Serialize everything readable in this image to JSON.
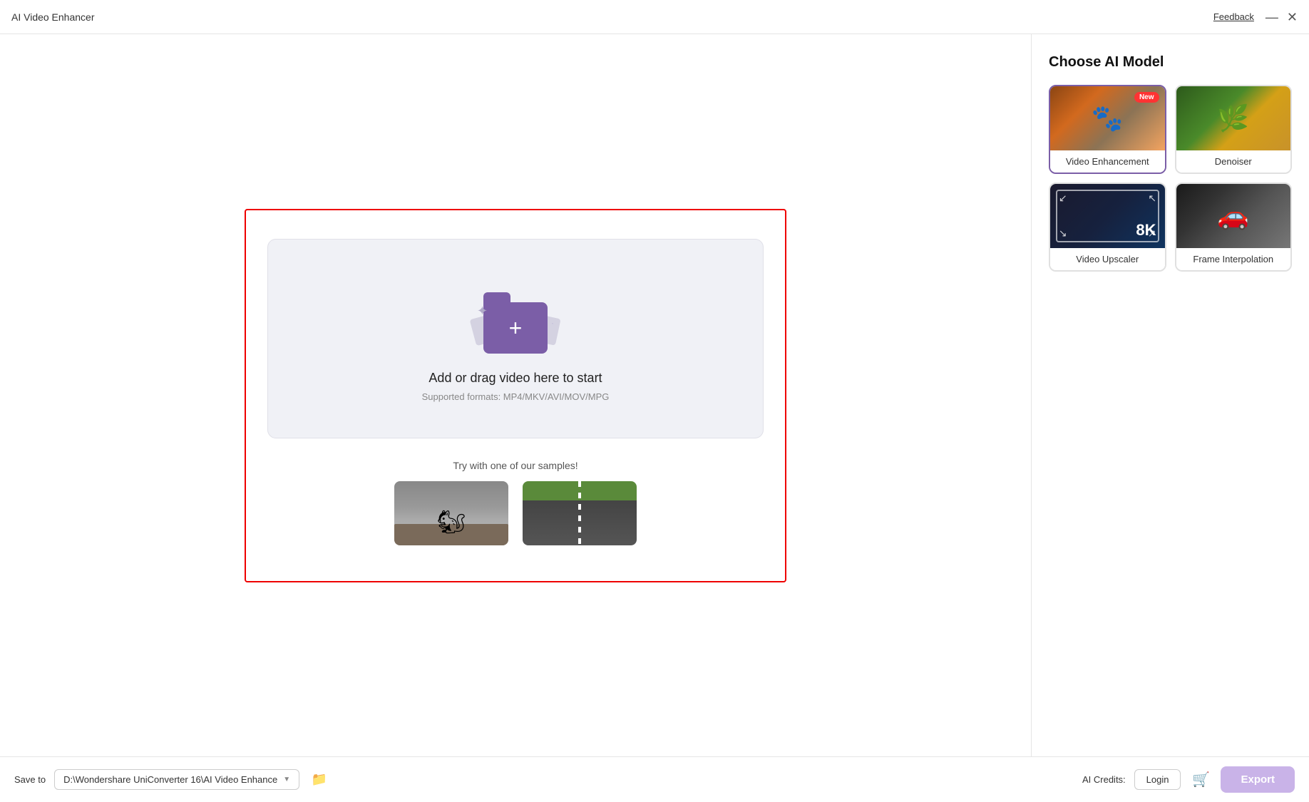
{
  "titleBar": {
    "appTitle": "AI Video Enhancer",
    "feedbackLabel": "Feedback",
    "minimize": "—",
    "close": "✕"
  },
  "dropZone": {
    "uploadTitle": "Add or drag video here to start",
    "uploadSubtitle": "Supported formats: MP4/MKV/AVI/MOV/MPG",
    "samplesTitle": "Try with one of our samples!",
    "sample1Alt": "squirrel sample",
    "sample2Alt": "highway sample"
  },
  "rightPanel": {
    "title": "Choose AI Model",
    "models": [
      {
        "id": "enhancement",
        "label": "Video Enhancement",
        "isNew": true,
        "selected": true
      },
      {
        "id": "denoiser",
        "label": "Denoiser",
        "isNew": false,
        "selected": false
      },
      {
        "id": "upscaler",
        "label": "Video Upscaler",
        "isNew": false,
        "selected": false
      },
      {
        "id": "interpolation",
        "label": "Frame Interpolation",
        "isNew": false,
        "selected": false
      }
    ],
    "newBadge": "New"
  },
  "bottomBar": {
    "saveToLabel": "Save to",
    "savePath": "D:\\Wondershare UniConverter 16\\AI Video Enhance",
    "aiCreditsLabel": "AI Credits:",
    "loginLabel": "Login",
    "exportLabel": "Export"
  }
}
